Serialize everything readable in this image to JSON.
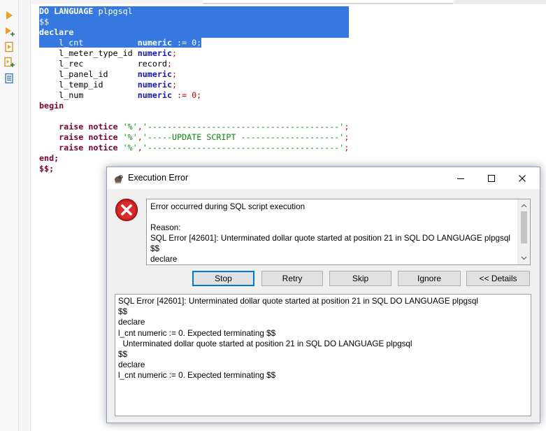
{
  "editor": {
    "lines": [
      {
        "kw": "DO LANGUAGE",
        "rest": " plpgsql"
      },
      {
        "text": "$$"
      },
      {
        "text": "declare"
      },
      {
        "name": "    l_cnt           ",
        "type": "numeric",
        "punct": " := 0;"
      },
      {
        "name": "    l_meter_type_id ",
        "type": "numeric",
        "punct": ";"
      },
      {
        "name": "    l_rec           ",
        "type": "record",
        "punct": ";"
      },
      {
        "name": "    l_panel_id      ",
        "type": "numeric",
        "punct": ";"
      },
      {
        "name": "    l_temp_id       ",
        "type": "numeric",
        "punct": ";"
      },
      {
        "name": "    l_num           ",
        "type": "numeric",
        "punct": " := 0;"
      },
      {
        "text": "begin"
      },
      {
        "text": ""
      },
      {
        "kw": "    raise notice",
        "s1": "'%'",
        "c": ",",
        "s2": "'---------------------------------------'",
        "p": ";"
      },
      {
        "kw": "    raise notice",
        "s1": "'%'",
        "c": ",",
        "s2": "'-----UPDATE SCRIPT --------------------'",
        "p": ";"
      },
      {
        "kw": "    raise notice",
        "s1": "'%'",
        "c": ",",
        "s2": "'---------------------------------------'",
        "p": ";"
      },
      {
        "text": "end;"
      },
      {
        "text": "$$;"
      }
    ]
  },
  "dialog": {
    "title": "Execution Error",
    "message": "Error occurred during SQL script execution\n\nReason:\nSQL Error [42601]: Unterminated dollar quote started at position 21 in SQL DO LANGUAGE plpgsql\n$$\ndeclare",
    "buttons": {
      "stop": "Stop",
      "retry": "Retry",
      "skip": "Skip",
      "ignore": "Ignore",
      "details": "<< Details"
    },
    "details": "SQL Error [42601]: Unterminated dollar quote started at position 21 in SQL DO LANGUAGE plpgsql\n$$\ndeclare\nl_cnt numeric := 0. Expected terminating $$\n  Unterminated dollar quote started at position 21 in SQL DO LANGUAGE plpgsql\n$$\ndeclare\nl_cnt numeric := 0. Expected terminating $$"
  }
}
